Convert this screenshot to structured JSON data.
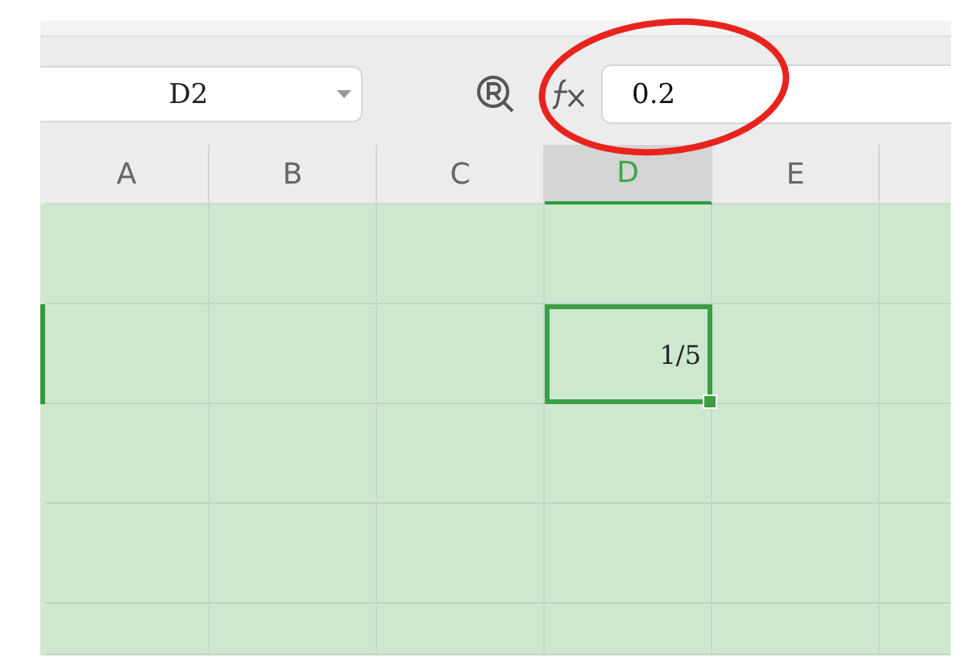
{
  "name_box": {
    "value": "D2"
  },
  "formula_bar": {
    "value": "0.2"
  },
  "columns": [
    {
      "label": "A",
      "selected": false
    },
    {
      "label": "B",
      "selected": false
    },
    {
      "label": "C",
      "selected": false
    },
    {
      "label": "D",
      "selected": true
    },
    {
      "label": "E",
      "selected": false
    }
  ],
  "rows": [
    {
      "cells": [
        {
          "selected": false
        },
        {
          "selected": false
        },
        {
          "selected": false
        },
        {
          "selected": false
        },
        {
          "selected": false
        }
      ]
    },
    {
      "cells": [
        {
          "selected": false
        },
        {
          "selected": false
        },
        {
          "selected": false
        },
        {
          "selected": true,
          "value": "1/5"
        },
        {
          "selected": false
        }
      ]
    },
    {
      "cells": [
        {
          "selected": false
        },
        {
          "selected": false
        },
        {
          "selected": false
        },
        {
          "selected": false
        },
        {
          "selected": false
        }
      ]
    },
    {
      "cells": [
        {
          "selected": false
        },
        {
          "selected": false
        },
        {
          "selected": false
        },
        {
          "selected": false
        },
        {
          "selected": false
        }
      ]
    },
    {
      "cells": [
        {
          "selected": false
        },
        {
          "selected": false
        },
        {
          "selected": false
        },
        {
          "selected": false
        },
        {
          "selected": false
        }
      ]
    }
  ]
}
